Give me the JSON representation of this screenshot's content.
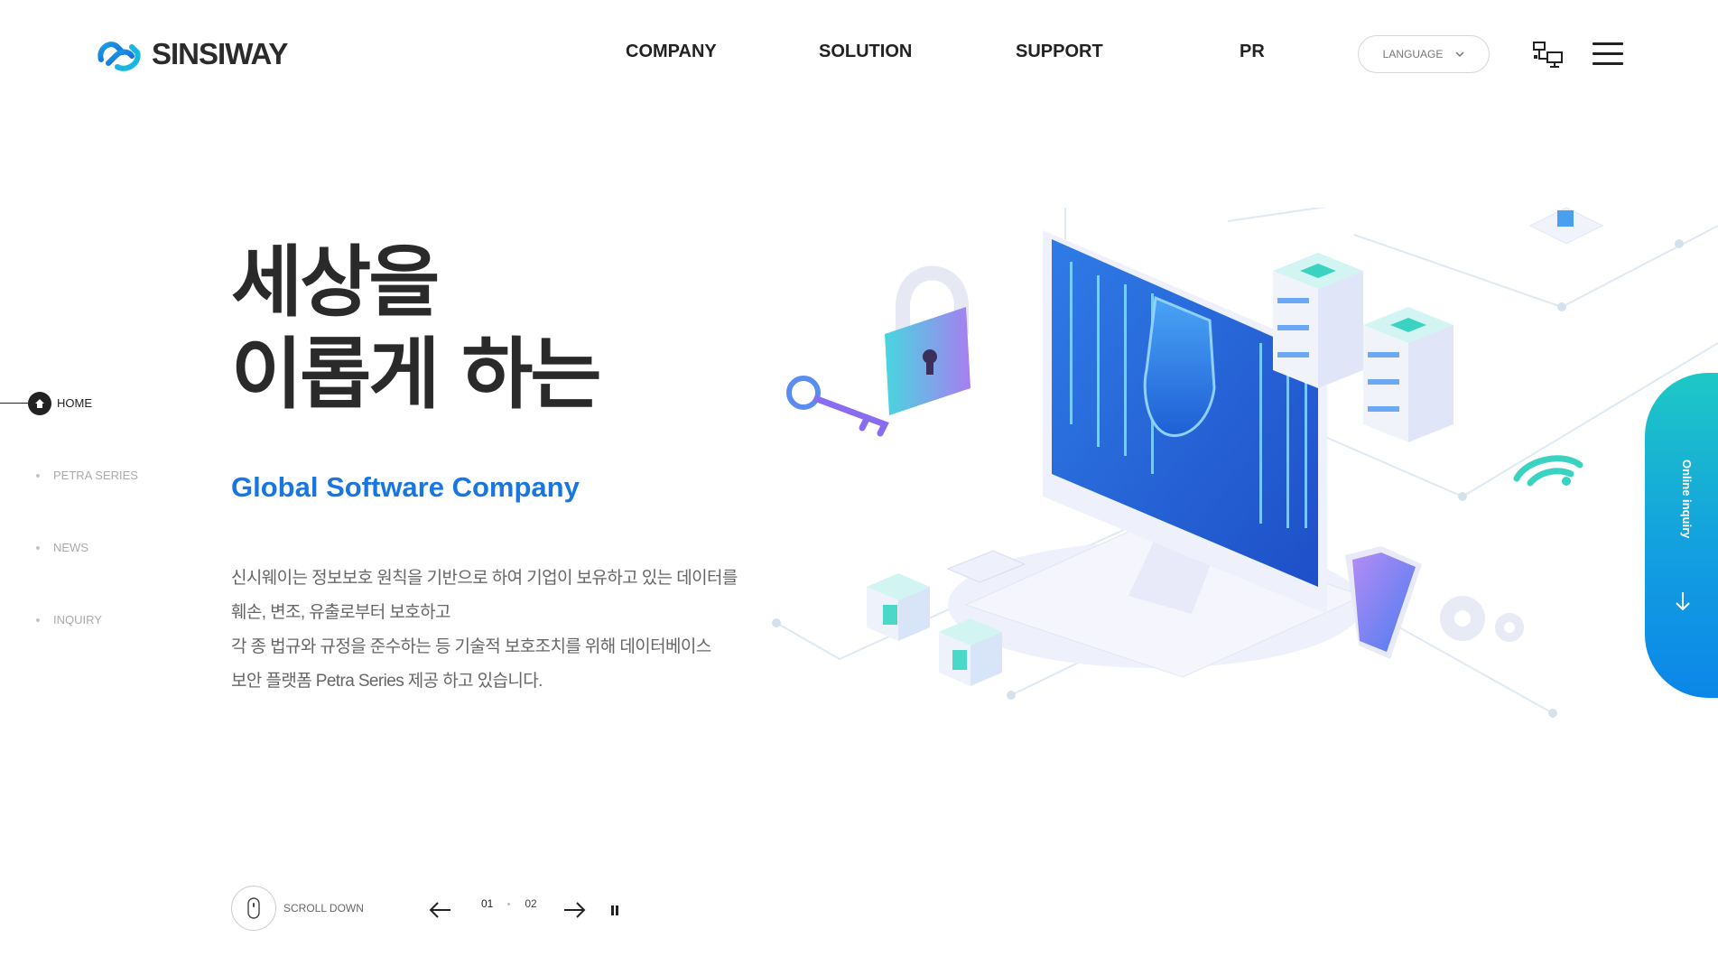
{
  "header": {
    "logo_text": "SINSIWAY",
    "nav": [
      "COMPANY",
      "SOLUTION",
      "SUPPORT",
      "PR"
    ],
    "language_label": "LANGUAGE"
  },
  "side_nav": {
    "items": [
      "HOME",
      "PETRA SERIES",
      "NEWS",
      "INQUIRY"
    ],
    "active": "HOME"
  },
  "hero": {
    "title_line1": "세상을",
    "title_line2": "이롭게 하는",
    "subtitle": "Global Software Company",
    "desc_lines": [
      "신시웨이는 정보보호 원칙을 기반으로 하여 기업이 보유하고 있는 데이터를",
      "훼손, 변조, 유출로부터 보호하고",
      "각 종 법규와 규정을 준수하는 등 기술적 보호조치를 위해 데이터베이스",
      "보안 플랫폼 Petra Series 제공 하고 있습니다."
    ]
  },
  "controls": {
    "scroll_label": "SCROLL DOWN",
    "current_page": "01",
    "total_pages": "02"
  },
  "inquiry": {
    "label": "Online inquiry"
  },
  "colors": {
    "accent_blue": "#1976e0",
    "inquiry_gradient_top": "#1ec8c5",
    "inquiry_gradient_bottom": "#0c86e8",
    "text_dark": "#2a2a2a"
  }
}
